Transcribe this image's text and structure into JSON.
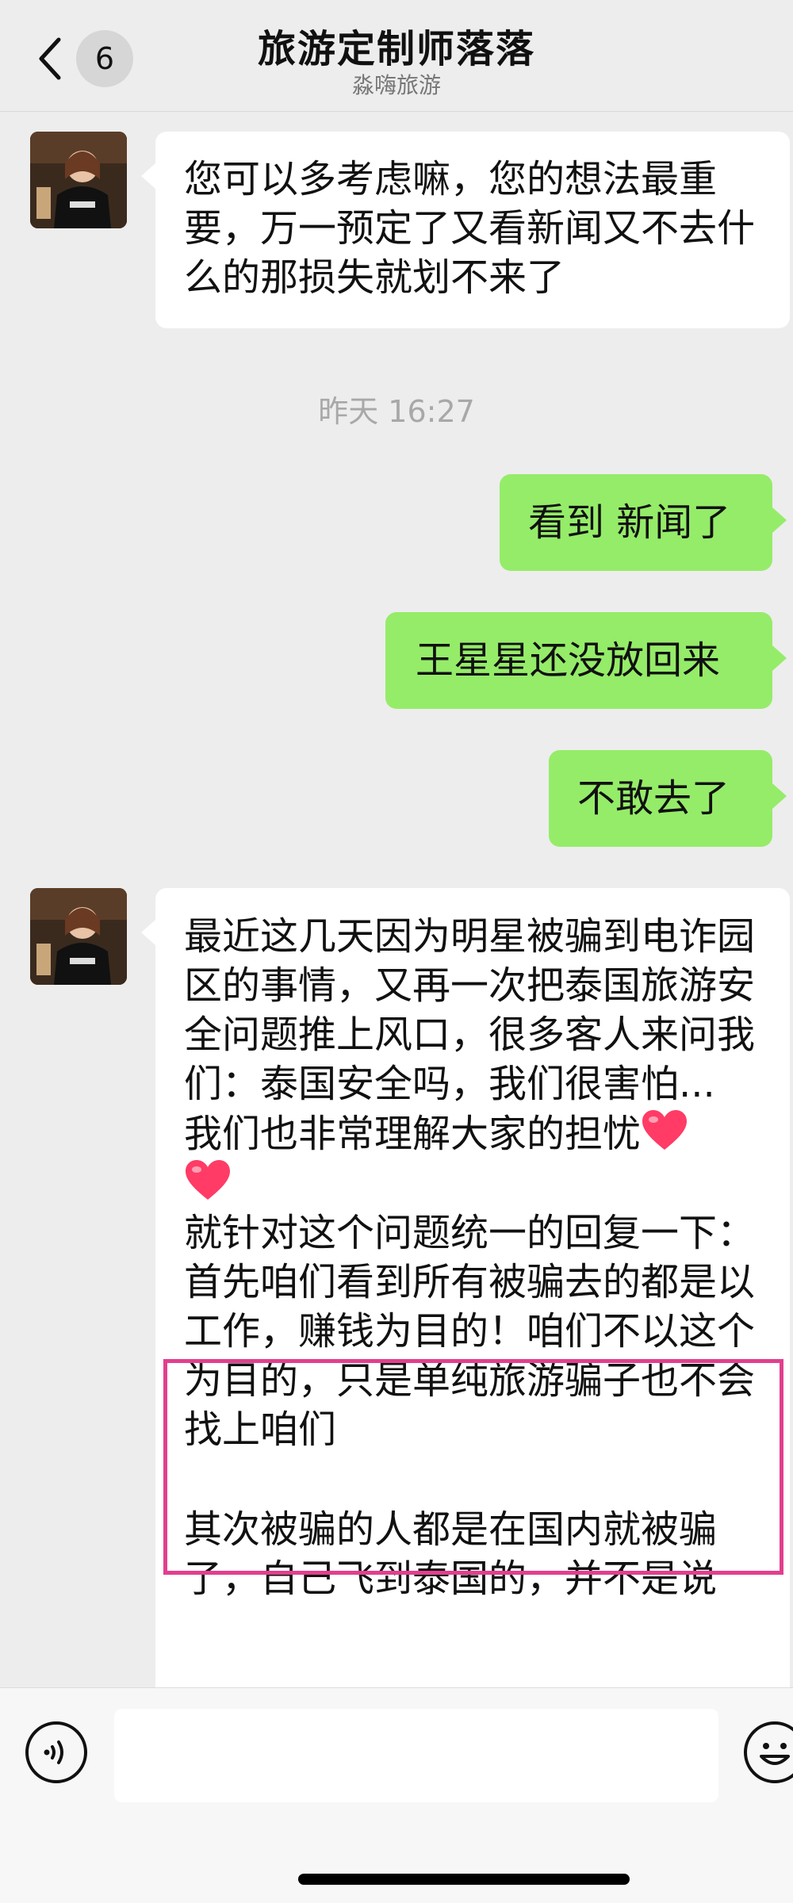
{
  "header": {
    "back_icon": "chevron-left-icon",
    "unread_count": "6",
    "title": "旅游定制师落落",
    "subtitle": "淼嗨旅游"
  },
  "messages": [
    {
      "direction": "incoming",
      "text": "您可以多考虑嘛，您的想法最重要，万一预定了又看新闻又不去什么的那损失就划不来了"
    },
    {
      "timestamp": "昨天 16:27"
    },
    {
      "direction": "outgoing",
      "text": "看到 新闻了"
    },
    {
      "direction": "outgoing",
      "text": "王星星还没放回来"
    },
    {
      "direction": "outgoing",
      "text": "不敢去了"
    },
    {
      "direction": "incoming",
      "paragraphs": [
        "最近这几天因为明星被骗到电诈园区的事情，又再一次把泰国旅游安全问题推上风口，很多客人来问我们：泰国安全吗，我们很害怕...",
        "我们也非常理解大家的担忧",
        "就针对这个问题统一的回复一下：",
        "首先咱们看到所有被骗去的都是以工作，赚钱为目的！咱们不以这个为目的，只是单纯旅游骗子也不会找上咱们",
        "其次被骗的人都是在国内就被骗了，自己飞到泰国的，并不是说"
      ],
      "emoji": [
        "heart-emoji",
        "heart-emoji"
      ]
    }
  ],
  "input_bar": {
    "voice_icon": "voice-icon",
    "placeholder": "",
    "emoji_icon": "emoji-icon"
  },
  "colors": {
    "background": "#ededed",
    "outgoing_bubble": "#95ec69",
    "incoming_bubble": "#ffffff",
    "highlight": "#e23f8e"
  }
}
